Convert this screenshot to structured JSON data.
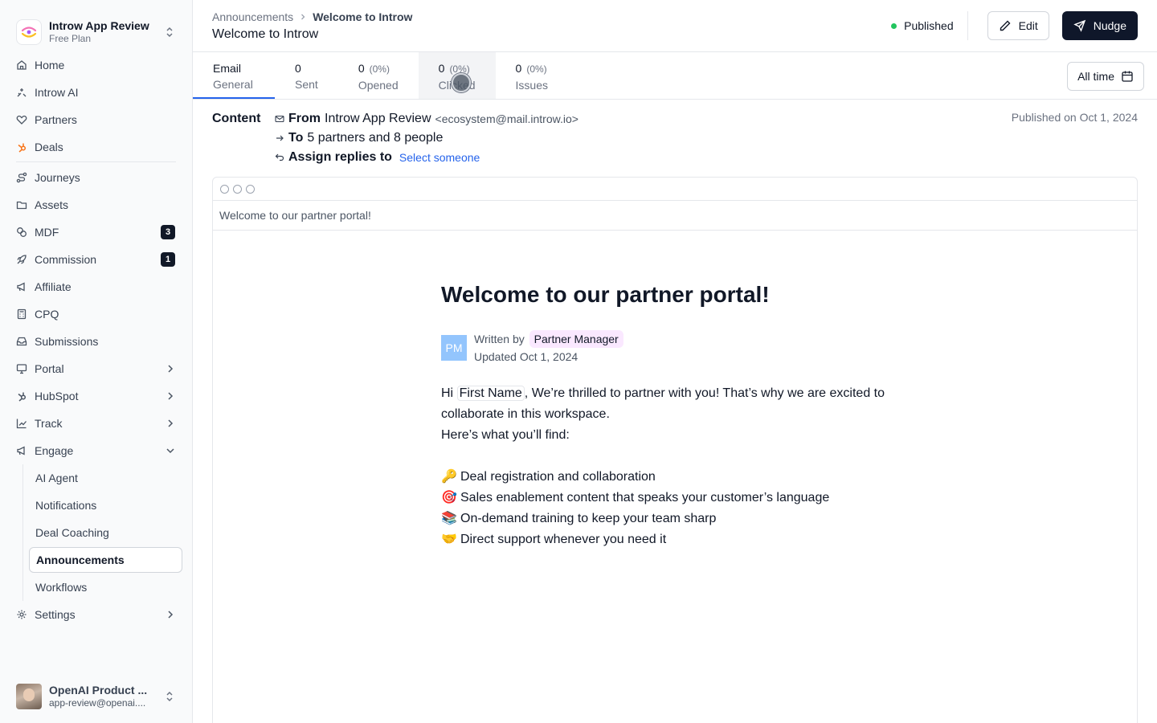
{
  "workspace": {
    "name": "Introw App Review",
    "plan": "Free Plan"
  },
  "sidebar": {
    "items": [
      {
        "label": "Home",
        "icon": "home-icon"
      },
      {
        "label": "Introw AI",
        "icon": "sparkle-icon"
      },
      {
        "label": "Partners",
        "icon": "handshake-icon"
      },
      {
        "label": "Deals",
        "icon": "hubspot-icon"
      },
      {
        "label": "Journeys",
        "icon": "route-icon"
      },
      {
        "label": "Assets",
        "icon": "folder-icon"
      },
      {
        "label": "MDF",
        "icon": "coins-icon",
        "badge": "3"
      },
      {
        "label": "Commission",
        "icon": "rocket-icon",
        "badge": "1"
      },
      {
        "label": "Affiliate",
        "icon": "megaphone-icon"
      },
      {
        "label": "CPQ",
        "icon": "calculator-icon"
      },
      {
        "label": "Submissions",
        "icon": "inbox-icon"
      },
      {
        "label": "Portal",
        "icon": "monitor-icon"
      },
      {
        "label": "HubSpot",
        "icon": "hubspot-icon"
      },
      {
        "label": "Track",
        "icon": "chart-icon"
      },
      {
        "label": "Engage",
        "icon": "megaphone-icon"
      }
    ],
    "engage_sub": [
      "AI Agent",
      "Notifications",
      "Deal Coaching",
      "Announcements",
      "Workflows"
    ],
    "settings": "Settings"
  },
  "user": {
    "name": "OpenAI Product ...",
    "email": "app-review@openai...."
  },
  "header": {
    "breadcrumb_parent": "Announcements",
    "breadcrumb_current": "Welcome to Introw",
    "title": "Welcome to Introw",
    "status": "Published",
    "edit": "Edit",
    "nudge": "Nudge"
  },
  "stats": {
    "email": {
      "top": "Email",
      "label": "General"
    },
    "sent": {
      "value": "0",
      "label": "Sent"
    },
    "opened": {
      "value": "0",
      "pct": "(0%)",
      "label": "Opened"
    },
    "clicked": {
      "value": "0",
      "pct": "(0%)",
      "label": "Clicked"
    },
    "issues": {
      "value": "0",
      "pct": "(0%)",
      "label": "Issues"
    },
    "range": "All time"
  },
  "content": {
    "heading": "Content",
    "from_label": "From",
    "from_name": "Introw App Review",
    "from_email": "<ecosystem@mail.introw.io>",
    "to_label": "To",
    "to_value": "5 partners and 8 people",
    "assign_label": "Assign replies to",
    "assign_link": "Select someone",
    "published_on": "Published on Oct 1, 2024"
  },
  "preview": {
    "subject": "Welcome to our partner portal!",
    "title": "Welcome to our partner portal!",
    "avatar_initials": "PM",
    "written_by": "Written by",
    "author": "Partner Manager",
    "updated": "Updated Oct 1, 2024",
    "greeting": "Hi",
    "variable": "First Name",
    "intro_rest": ", We’re thrilled to partner with you! That’s why we are excited to collaborate in this workspace.",
    "find": "Here’s what you’ll find:",
    "bullets": [
      {
        "emoji": "🔑",
        "text": "Deal registration and collaboration"
      },
      {
        "emoji": "🎯",
        "text": "Sales enablement content that speaks your customer’s language"
      },
      {
        "emoji": "📚",
        "text": "On-demand training to keep your team sharp"
      },
      {
        "emoji": "🤝",
        "text": "Direct support whenever you need it"
      }
    ]
  }
}
